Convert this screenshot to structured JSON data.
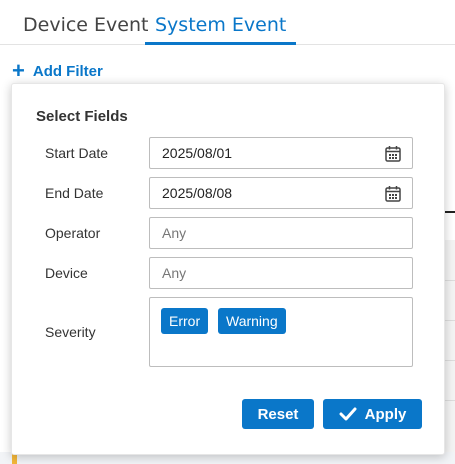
{
  "tabs": [
    {
      "label": "Device Event",
      "active": false
    },
    {
      "label": "System Event",
      "active": true
    }
  ],
  "add_filter": {
    "label": "Add Filter",
    "icon": "plus-icon"
  },
  "panel": {
    "title": "Select Fields",
    "fields": {
      "start_date": {
        "label": "Start Date",
        "value": "2025/08/01",
        "icon": "calendar-icon"
      },
      "end_date": {
        "label": "End Date",
        "value": "2025/08/08",
        "icon": "calendar-icon"
      },
      "operator": {
        "label": "Operator",
        "value": "Any"
      },
      "device": {
        "label": "Device",
        "value": "Any"
      },
      "severity": {
        "label": "Severity",
        "chips": [
          "Error",
          "Warning"
        ]
      }
    },
    "buttons": {
      "reset": "Reset",
      "apply": "Apply"
    }
  },
  "colors": {
    "accent": "#0a77c9",
    "marker": "#f3b73a"
  }
}
